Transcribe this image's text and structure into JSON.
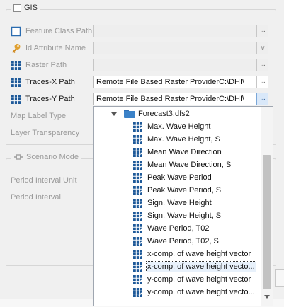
{
  "gis_group": {
    "title": "GIS",
    "rows": [
      {
        "label": "Feature Class Path",
        "value": "",
        "icon": "square-outline-icon",
        "enabled": false
      },
      {
        "label": "Id Attribute Name",
        "value": "",
        "icon": "key-icon",
        "enabled": false
      },
      {
        "label": "Raster Path",
        "value": "",
        "icon": "grid-icon",
        "enabled": false
      },
      {
        "label": "Traces-X Path",
        "value": "Remote File Based Raster ProviderC:\\DHI\\Cust",
        "icon": "grid-icon",
        "enabled": true
      },
      {
        "label": "Traces-Y Path",
        "value": "Remote File Based Raster ProviderC:\\DHI\\Cust",
        "icon": "grid-icon",
        "enabled": true
      }
    ],
    "map_label_type": "Map Label Type",
    "layer_transparency": "Layer Transparency",
    "browse_glyph": "···",
    "dropdown_glyph": "∨"
  },
  "scenario_group": {
    "title": "Scenario Mode",
    "period_interval_unit": "Period Interval Unit",
    "period_interval": "Period Interval"
  },
  "dropdown": {
    "root": "Forecast3.dfs2",
    "items": [
      "Max. Wave Height",
      "Max. Wave Height, S",
      "Mean Wave Direction",
      "Mean Wave Direction, S",
      "Peak Wave Period",
      "Peak Wave Period, S",
      "Sign. Wave Height",
      "Sign. Wave Height, S",
      "Wave Period, T02",
      "Wave Period, T02, S",
      "x-comp. of wave height vector",
      "x-comp. of wave height vecto...",
      "y-comp. of wave height vector",
      "y-comp. of wave height vecto..."
    ],
    "selected_index": 11
  },
  "colors": {
    "accent": "#2b6cb0",
    "grid_icon": "#1f5a99"
  }
}
